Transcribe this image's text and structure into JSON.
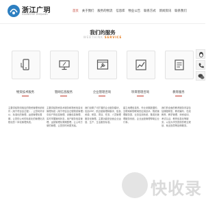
{
  "header": {
    "brand": "浙江广玥",
    "brand_sub": "GUANGYUE ZHEJIANG",
    "nav": [
      {
        "label": "首页"
      },
      {
        "label": "关于我们"
      },
      {
        "label": "服务的物流"
      },
      {
        "label": "信息库"
      },
      {
        "label": "物业公告"
      },
      {
        "label": "联系方式"
      },
      {
        "label": "新闻资讯"
      },
      {
        "label": "联系我们"
      }
    ]
  },
  "services": {
    "title": "我们的服务",
    "subtitle_en": "WEBTHINK ",
    "subtitle_accent": "SERVICE",
    "items": [
      {
        "icon": "mobile-icon",
        "title": "物资技术服务",
        "desc": "主要供给物流相应的物资管理系统软件（用于项目全过程）、让您利好评价、标准化的管理，运营管理化周期，让您的公司的标准化的管理化流程化的一体化管理系统。"
      },
      {
        "icon": "monitor-icon",
        "title": "管网信息服务",
        "desc": "主要供给物资技术服务和物资信息化管理系统（用于项目全过程物资管理）中用户的信息管理、设备信息管理、实时掌握管网状态，用户服务信息管理，运营管理化周期整理，让公司方便的管理，让您的时间更充裕。"
      },
      {
        "icon": "wrench-icon",
        "title": "企业管理咨询",
        "desc": "我们设置了可扩展的企业服务模块，包括ERP，供应链管理和模块、信息、资源、研发、项目、任务、人员管理服务化管理。主要功能是全面企业运营、生产、生活服务标准。"
      },
      {
        "icon": "chart-icon",
        "title": "项目管理咨询",
        "desc": "建立地理信息的、外业采集数据的、互联网和物联网的应用技术、物资管理服务类、业务应用系统、集成化管理服务系统。企业运营管理帮助企业行事。"
      },
      {
        "icon": "document-icon",
        "title": "教育服务",
        "desc": "我们的全面的教育服务内容包括课程研发、教材编写、在线教育、教学管理、师资培训、考试认证、教育信息化等服务，以及为学员提供的职业规划、就业指导等延伸服务。"
      }
    ]
  },
  "side_tools": [
    {
      "icon": "qq-icon"
    },
    {
      "icon": "phone-icon"
    },
    {
      "icon": "wechat-icon"
    }
  ],
  "watermark": {
    "text": "快收录"
  },
  "colors": {
    "accent": "#c0392b",
    "subtitle_accent": "#e67e22"
  }
}
